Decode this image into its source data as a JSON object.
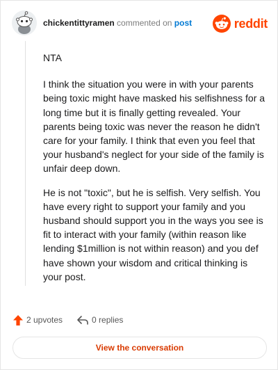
{
  "header": {
    "username": "chickentittyramen",
    "action_text": "commented on",
    "target_link": "post",
    "brand": "reddit",
    "avatar_icon": "snoo-avatar-icon",
    "logo_icon": "reddit-alien-icon",
    "brand_color": "#ff4500"
  },
  "comment": {
    "paragraphs": [
      "NTA",
      "I think the situation you were in with your parents being toxic might have masked his selfishness for a long time but it is finally getting revealed. Your parents being toxic was never the reason he didn't care for your family. I think that even you feel that your husband's neglect for your side of the family is unfair deep down.",
      "He is not \"toxic\", but he is selfish. Very selfish. You have every right to support your family and you husband should support you in the ways you see is fit to interact with your family (within reason like lending $1million is not within reason) and you def have shown your wisdom and critical thinking is your post."
    ]
  },
  "actions": {
    "upvotes": "2 upvotes",
    "replies": "0 replies",
    "upvote_icon": "upvote-arrow-icon",
    "reply_icon": "reply-arrow-icon"
  },
  "cta": {
    "label": "View the conversation"
  }
}
